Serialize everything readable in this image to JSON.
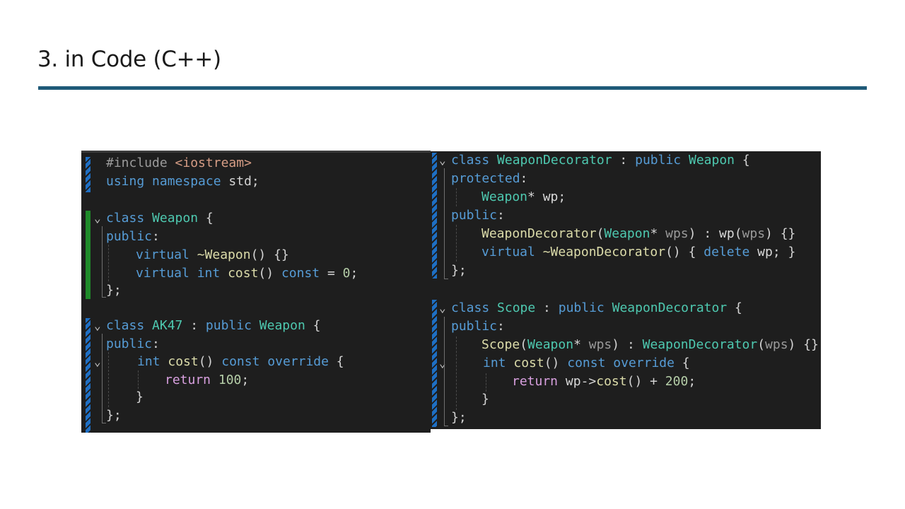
{
  "slide": {
    "title": "3. in Code (C++)"
  },
  "colors": {
    "rule": "#1f5a78",
    "editor_bg": "#1e1e1e",
    "keyword": "#569cd6",
    "control_keyword": "#d8a0df",
    "type": "#4ec9b0",
    "function": "#dcdcaa",
    "number": "#b5cea8",
    "string": "#d69d85"
  },
  "left_code": {
    "l1": {
      "pp": "#include",
      "sp": " ",
      "str": "<iostream>"
    },
    "l2": {
      "k1": "using",
      "s1": " ",
      "k2": "namespace",
      "s2": " ",
      "id": "std;"
    },
    "l3": {
      "k1": "class",
      "s1": " ",
      "t1": "Weapon",
      "s2": " {"
    },
    "l4": {
      "k1": "public",
      "p": ":"
    },
    "l5": {
      "k1": "virtual",
      "s1": " ",
      "f1": "~Weapon",
      "p": "() {}"
    },
    "l6": {
      "k1": "virtual",
      "s1": " ",
      "k2": "int",
      "s2": " ",
      "f1": "cost",
      "p1": "() ",
      "k3": "const",
      "p2": " = ",
      "n": "0",
      "p3": ";"
    },
    "l7": {
      "p": "};"
    },
    "l8": {
      "k1": "class",
      "s1": " ",
      "t1": "AK47",
      "p1": " : ",
      "k2": "public",
      "s2": " ",
      "t2": "Weapon",
      "p2": " {"
    },
    "l9": {
      "k1": "public",
      "p": ":"
    },
    "l10": {
      "k1": "int",
      "s1": " ",
      "f1": "cost",
      "p1": "() ",
      "k2": "const",
      "s2": " ",
      "k3": "override",
      "p2": " {"
    },
    "l11": {
      "c1": "return",
      "s1": " ",
      "n": "100",
      "p": ";"
    },
    "l12": {
      "p": "}"
    },
    "l13": {
      "p": "};"
    }
  },
  "right_code": {
    "l1": {
      "k1": "class",
      "s1": " ",
      "t1": "WeaponDecorator",
      "p1": " : ",
      "k2": "public",
      "s2": " ",
      "t2": "Weapon",
      "p2": " {"
    },
    "l2": {
      "k1": "protected",
      "p": ":"
    },
    "l3": {
      "t1": "Weapon",
      "p1": "* ",
      "id": "wp",
      "p2": ";"
    },
    "l4": {
      "k1": "public",
      "p": ":"
    },
    "l5": {
      "f1": "WeaponDecorator",
      "p1": "(",
      "t1": "Weapon",
      "p2": "* ",
      "prm1": "wps",
      "p3": ") : ",
      "id": "wp",
      "p4": "(",
      "prm2": "wps",
      "p5": ") {}"
    },
    "l6": {
      "k1": "virtual",
      "s1": " ",
      "f1": "~WeaponDecorator",
      "p1": "() { ",
      "k2": "delete",
      "s2": " ",
      "id": "wp",
      "p2": "; }"
    },
    "l7": {
      "p": "};"
    },
    "l8": {
      "k1": "class",
      "s1": " ",
      "t1": "Scope",
      "p1": " : ",
      "k2": "public",
      "s2": " ",
      "t2": "WeaponDecorator",
      "p2": " {"
    },
    "l9": {
      "k1": "public",
      "p": ":"
    },
    "l10": {
      "f1": "Scope",
      "p1": "(",
      "t1": "Weapon",
      "p2": "* ",
      "prm1": "wps",
      "p3": ") : ",
      "t2": "WeaponDecorator",
      "p4": "(",
      "prm2": "wps",
      "p5": ") {}"
    },
    "l11": {
      "k1": "int",
      "s1": " ",
      "f1": "cost",
      "p1": "() ",
      "k2": "const",
      "s2": " ",
      "k3": "override",
      "p2": " {"
    },
    "l12": {
      "c1": "return",
      "s1": " ",
      "id": "wp",
      "p1": "->",
      "f1": "cost",
      "p2": "() + ",
      "n": "200",
      "p3": ";"
    },
    "l13": {
      "p": "}"
    },
    "l14": {
      "p": "};"
    }
  },
  "icons": {
    "fold": "chevron-down-icon"
  },
  "fold_glyph": "⌄"
}
